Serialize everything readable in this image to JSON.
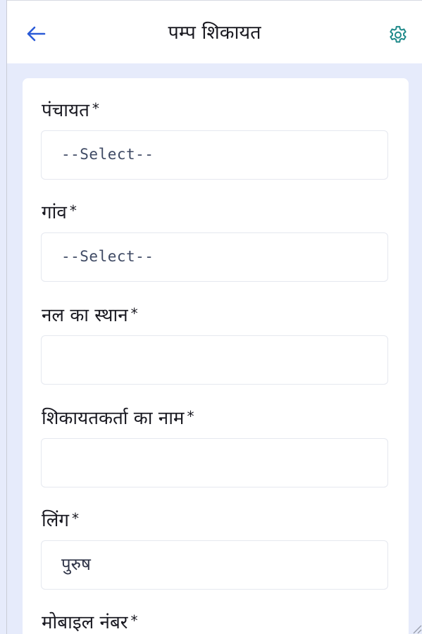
{
  "header": {
    "title": "पम्प शिकायत",
    "back_icon": "arrow-left-icon",
    "settings_icon": "gear-icon"
  },
  "colors": {
    "accent": "#2b5bd7",
    "page_background": "#e6ebfb",
    "card_background": "#ffffff"
  },
  "form": {
    "panchayat": {
      "label": "पंचायत",
      "required_mark": "*",
      "value": "--Select--"
    },
    "village": {
      "label": "गांव",
      "required_mark": "*",
      "value": "--Select--"
    },
    "tap_location": {
      "label": "नल का स्थान",
      "required_mark": "*",
      "value": ""
    },
    "complainant_name": {
      "label": "शिकायतकर्ता का नाम",
      "required_mark": "*",
      "value": ""
    },
    "gender": {
      "label": "लिंग",
      "required_mark": "*",
      "value": "पुरुष"
    },
    "mobile": {
      "label": "मोबाइल नंबर",
      "required_mark": "*"
    }
  }
}
